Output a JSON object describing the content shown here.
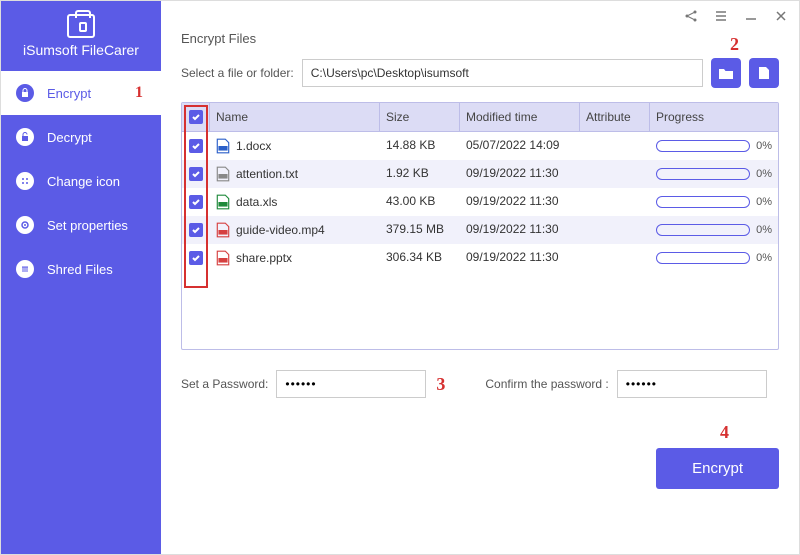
{
  "app": {
    "title": "iSumsoft FileCarer"
  },
  "sidebar": {
    "items": [
      {
        "label": "Encrypt",
        "icon": "lock-icon",
        "active": true,
        "badge": "1"
      },
      {
        "label": "Decrypt",
        "icon": "unlock-icon"
      },
      {
        "label": "Change icon",
        "icon": "grid-icon"
      },
      {
        "label": "Set properties",
        "icon": "gear-icon"
      },
      {
        "label": "Shred Files",
        "icon": "shred-icon"
      }
    ]
  },
  "main": {
    "section_title": "Encrypt Files",
    "path_label": "Select a file or folder:",
    "path_value": "C:\\Users\\pc\\Desktop\\isumsoft",
    "badge_2": "2",
    "table": {
      "headers": {
        "name": "Name",
        "size": "Size",
        "time": "Modified time",
        "attr": "Attribute",
        "prog": "Progress"
      },
      "rows": [
        {
          "name": "1.docx",
          "size": "14.88 KB",
          "time": "05/07/2022 14:09",
          "attr": "",
          "prog": "0%",
          "type": "docx"
        },
        {
          "name": "attention.txt",
          "size": "1.92 KB",
          "time": "09/19/2022 11:30",
          "attr": "",
          "prog": "0%",
          "type": "txt"
        },
        {
          "name": "data.xls",
          "size": "43.00 KB",
          "time": "09/19/2022 11:30",
          "attr": "",
          "prog": "0%",
          "type": "xls"
        },
        {
          "name": "guide-video.mp4",
          "size": "379.15 MB",
          "time": "09/19/2022 11:30",
          "attr": "",
          "prog": "0%",
          "type": "mp4"
        },
        {
          "name": "share.pptx",
          "size": "306.34 KB",
          "time": "09/19/2022 11:30",
          "attr": "",
          "prog": "0%",
          "type": "pptx"
        }
      ]
    },
    "password": {
      "set_label": "Set a Password:",
      "set_value": "••••••",
      "confirm_label": "Confirm the password :",
      "confirm_value": "••••••",
      "badge_3": "3"
    },
    "encrypt_button": "Encrypt",
    "badge_4": "4"
  },
  "file_colors": {
    "docx": "#2a5fc9",
    "txt": "#888",
    "xls": "#1f8a3b",
    "mp4": "#d64040",
    "pptx": "#d64040"
  }
}
